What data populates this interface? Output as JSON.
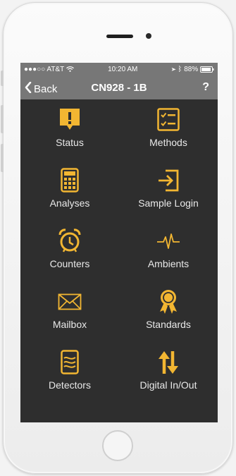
{
  "status_bar": {
    "carrier": "●●●○○ AT&T",
    "time": "10:20 AM",
    "battery": "88%"
  },
  "nav": {
    "back_label": "Back",
    "title": "CN928 - 1B",
    "help_label": "?"
  },
  "colors": {
    "accent": "#f2b632",
    "screen_bg": "#2e2e2e",
    "bar_bg": "#777777"
  },
  "tiles": [
    {
      "label": "Status",
      "icon": "exclamation-badge-icon"
    },
    {
      "label": "Methods",
      "icon": "checklist-icon"
    },
    {
      "label": "Analyses",
      "icon": "calculator-icon"
    },
    {
      "label": "Sample Login",
      "icon": "login-arrow-icon"
    },
    {
      "label": "Counters",
      "icon": "alarm-clock-icon"
    },
    {
      "label": "Ambients",
      "icon": "pulse-icon"
    },
    {
      "label": "Mailbox",
      "icon": "envelope-icon"
    },
    {
      "label": "Standards",
      "icon": "award-ribbon-icon"
    },
    {
      "label": "Detectors",
      "icon": "detector-card-icon"
    },
    {
      "label": "Digital In/Out",
      "icon": "swap-arrows-icon"
    }
  ]
}
